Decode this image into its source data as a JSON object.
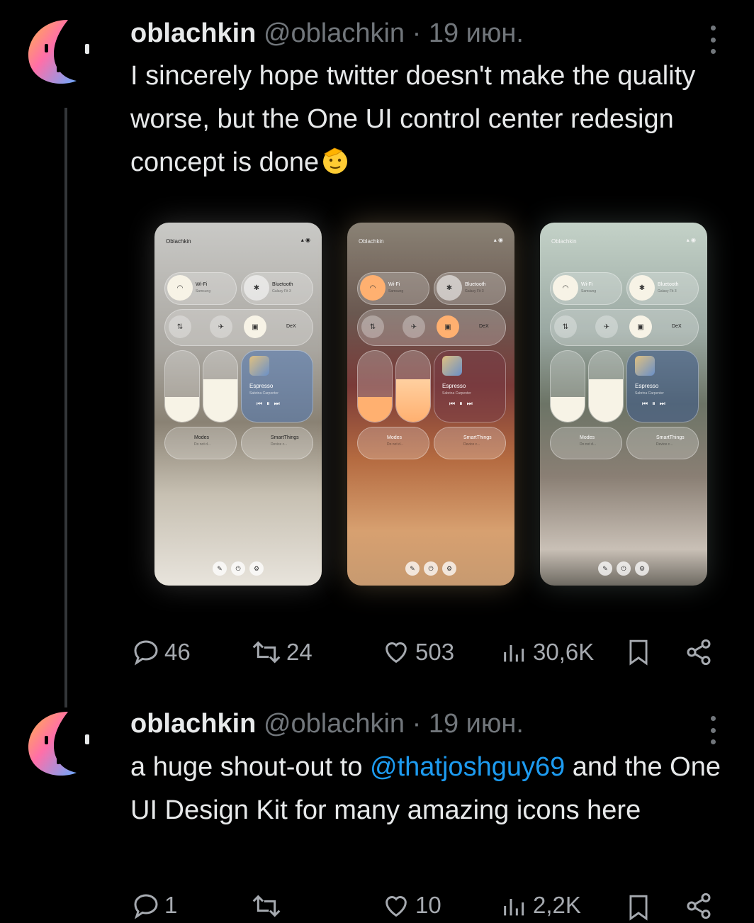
{
  "tweets": [
    {
      "author_name": "oblachkin",
      "handle": "@oblachkin",
      "separator": "·",
      "date": "19 июн.",
      "text": "I sincerely hope twitter doesn't make the quality worse, but the One UI control center redesign concept is done",
      "emoji": "saluting-face-emoji",
      "stats": {
        "replies": "46",
        "reposts": "24",
        "likes": "503",
        "views": "30,6K"
      }
    },
    {
      "author_name": "oblachkin",
      "handle": "@oblachkin",
      "separator": "·",
      "date": "19 июн.",
      "text_before": "a huge shout-out to ",
      "mention": "@thatjoshguy69",
      "text_after": " and the One UI Design Kit for many amazing icons here",
      "stats": {
        "replies": "1",
        "reposts": "",
        "likes": "10",
        "views": "2,2K"
      }
    }
  ],
  "mockup": {
    "owner": "Oblachkin",
    "wifi_label": "Wi-Fi",
    "wifi_sub": "Samsung",
    "bt_label": "Bluetooth",
    "bt_sub": "Galaxy Fit 3",
    "dex_label": "DeX",
    "song": "Espresso",
    "artist": "Sabrina Carpenter",
    "modes_label": "Modes",
    "modes_sub": "Do not d...",
    "st_label": "SmartThings",
    "st_sub": "Device c...",
    "phones": [
      {
        "theme": "cool-grey",
        "brightness_level": 0.35,
        "volume_level": 0.6
      },
      {
        "theme": "warm-floral",
        "brightness_level": 0.35,
        "volume_level": 0.6
      },
      {
        "theme": "sage-frost",
        "brightness_level": 0.35,
        "volume_level": 0.6
      }
    ]
  },
  "colors": {
    "background": "#000000",
    "text": "#e7e9ea",
    "secondary": "#71767b",
    "link": "#1d9bf0"
  }
}
